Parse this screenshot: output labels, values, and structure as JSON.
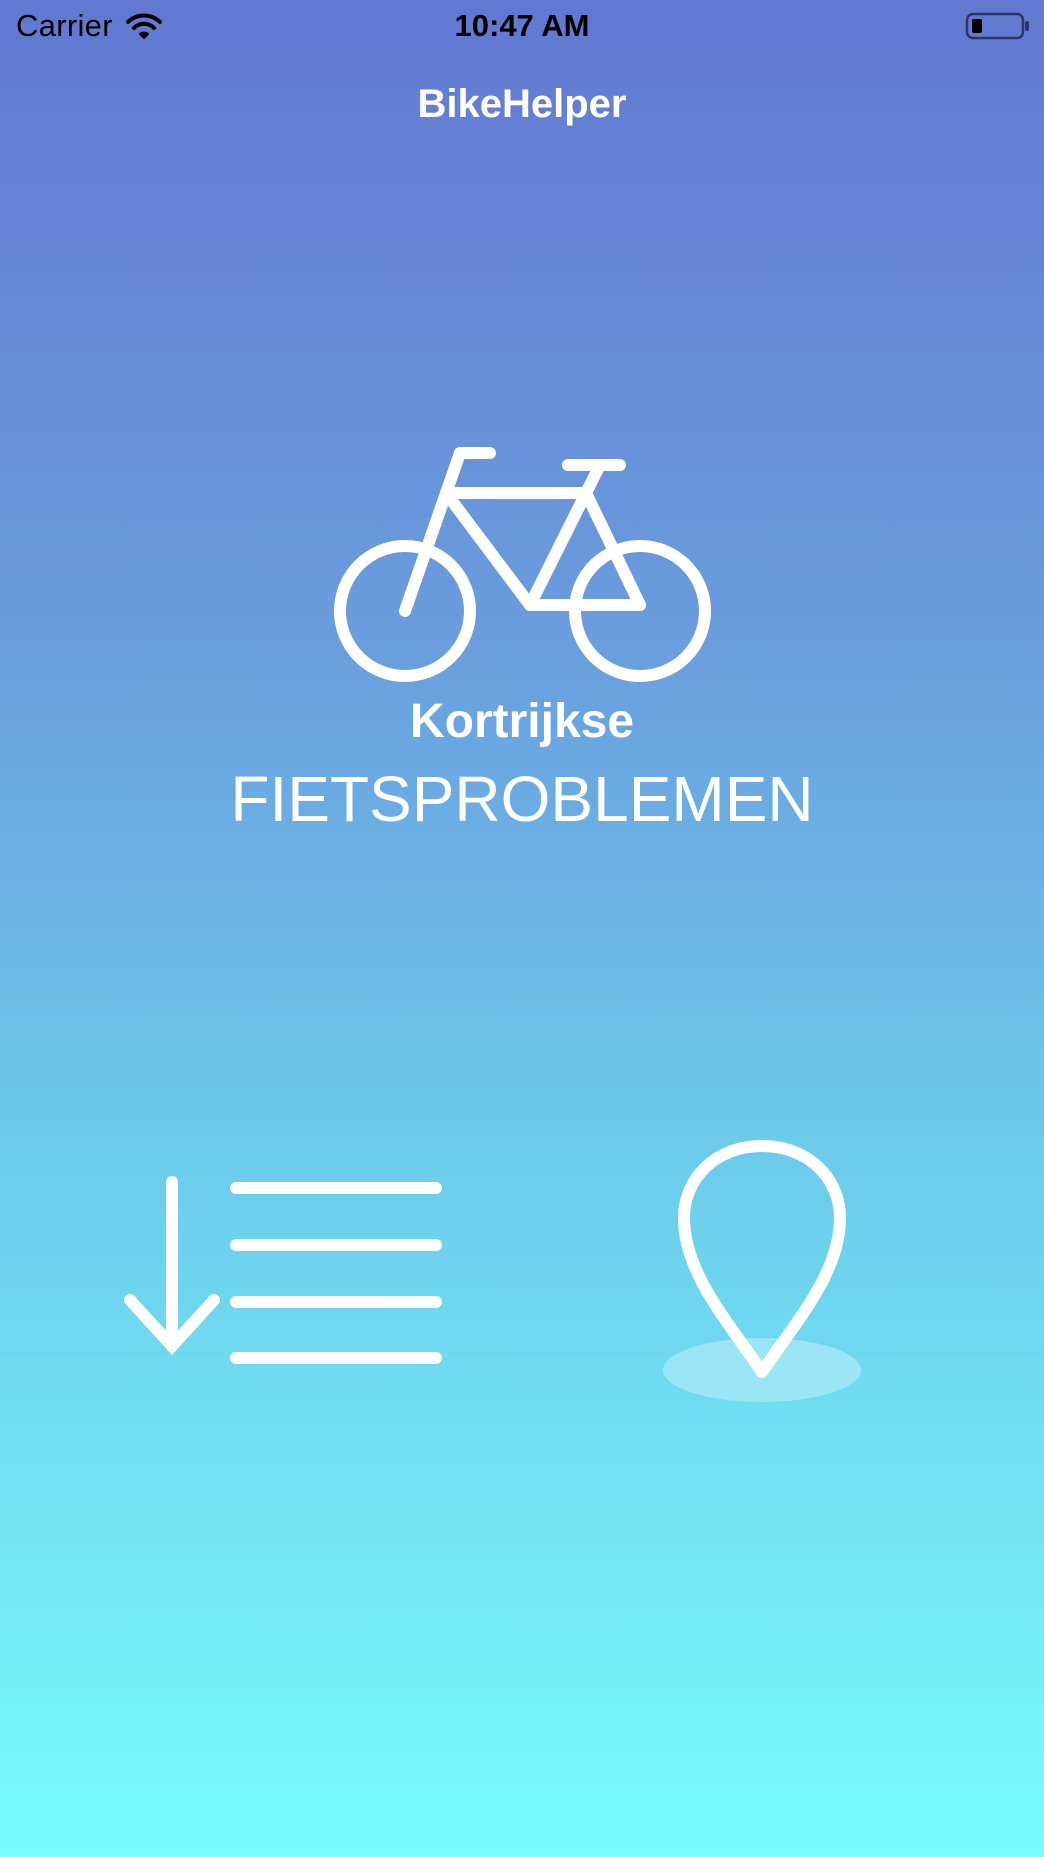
{
  "status_bar": {
    "carrier": "Carrier",
    "time": "10:47 AM"
  },
  "nav": {
    "title": "BikeHelper"
  },
  "hero": {
    "icon": "bicycle-icon",
    "title": "Kortrijkse",
    "subtitle": "FIETSPROBLEMEN"
  },
  "actions": {
    "list": {
      "icon": "sort-list-icon"
    },
    "map": {
      "icon": "map-pin-icon"
    }
  },
  "colors": {
    "gradient_top": "#6278d1",
    "gradient_bottom": "#78fcfd",
    "foreground": "#ffffff",
    "status_text": "#000000"
  }
}
